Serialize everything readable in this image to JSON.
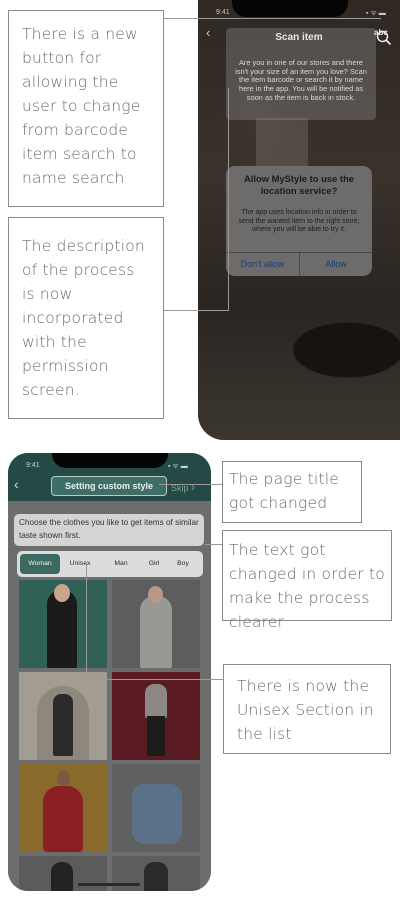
{
  "annotations": {
    "new_button": "There is a new button for allowing the user to change from barcode item search to name search",
    "description": "The description of the process is now incorporated with the permission screen.",
    "page_title": "The page title got changed",
    "text_changed": "The text got changed in order to make the process clearer",
    "unisex": "There is now the Unisex Section in the list"
  },
  "phone1": {
    "time": "9:41",
    "title": "Scan item",
    "toggle_label": "abc",
    "description": "Are you in one of our stores and there isn't your size of an item you love? Scan the item barcode or search it by name here in the app. You will be notified as soon as the item is back in stock.",
    "alert": {
      "title": "Allow MyStyle to use the location service?",
      "message": "The app uses location info in order to send the wanted item to the right store, where you will be able to try it.",
      "deny_label": "Don't allow",
      "allow_label": "Allow"
    }
  },
  "phone2": {
    "time": "9:41",
    "title": "Setting custom style",
    "skip_label": "Skip",
    "description": "Choose the clothes you like to get items of similar taste shown first.",
    "filters": [
      "Woman",
      "Unisex",
      "Man",
      "Girl",
      "Boy"
    ],
    "selected_filter": "Woman"
  },
  "colors": {
    "accent": "#3c6a63",
    "header": "#244a45"
  }
}
